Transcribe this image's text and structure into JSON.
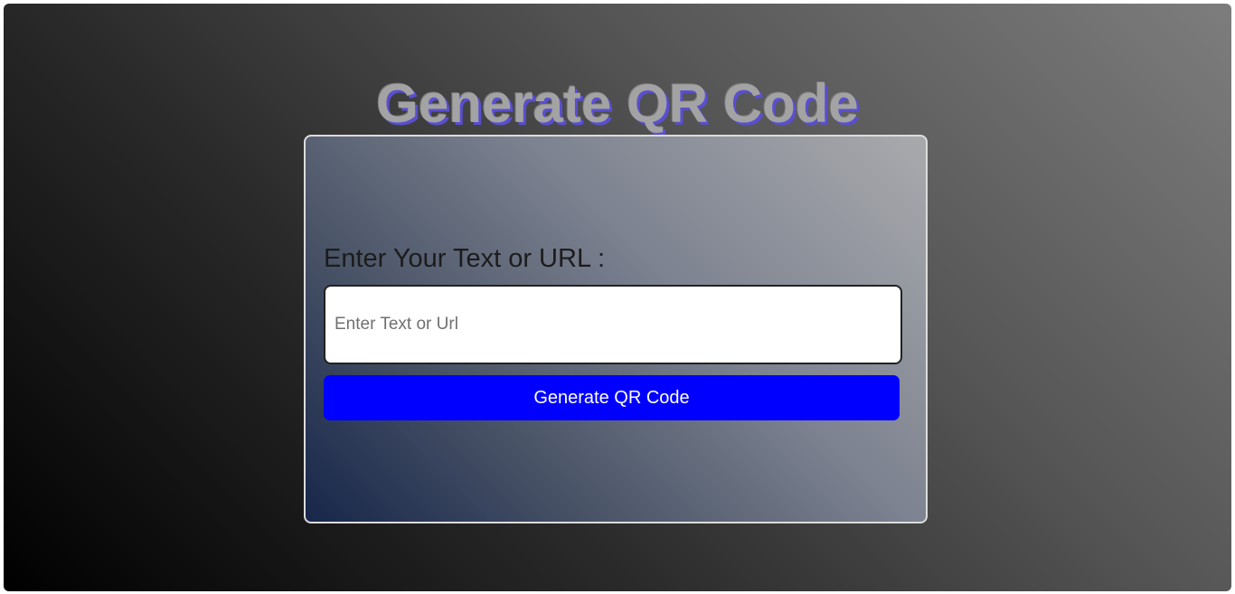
{
  "header": {
    "title": "Generate QR Code"
  },
  "form": {
    "label": "Enter Your Text or URL :",
    "input_placeholder": "Enter Text or Url",
    "input_value": "",
    "button_label": "Generate QR Code"
  },
  "colors": {
    "button_bg": "#0000ff",
    "title_shadow": "#5a4fd0",
    "title_text": "#a3a3a3"
  }
}
